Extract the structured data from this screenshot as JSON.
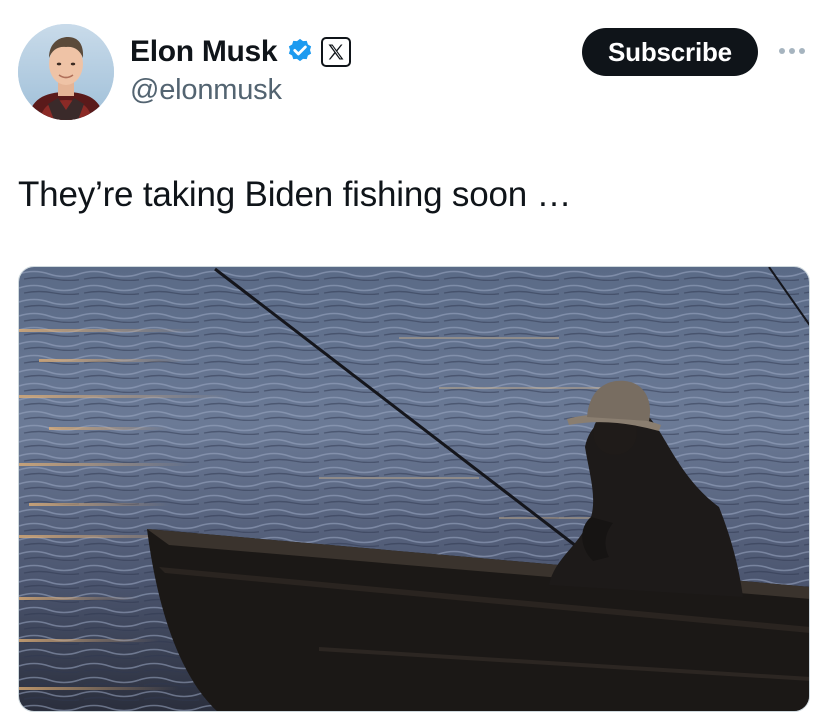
{
  "author": {
    "display_name": "Elon Musk",
    "handle": "@elonmusk",
    "verified_color": "#1d9bf0",
    "avatar_icon": "profile-avatar",
    "affiliation_icon": "x-logo-icon"
  },
  "actions": {
    "subscribe_label": "Subscribe",
    "more_icon": "more-horizontal-icon"
  },
  "tweet": {
    "text": "They’re taking Biden fishing soon …"
  },
  "media": {
    "type": "photo",
    "subject": "silhouette of a fisherman in a hat seated in a rowboat holding a fishing rod on sunset-lit water"
  },
  "colors": {
    "text_primary": "#0f1419",
    "text_secondary": "#536471",
    "button_bg": "#0f1419",
    "button_text": "#ffffff"
  }
}
